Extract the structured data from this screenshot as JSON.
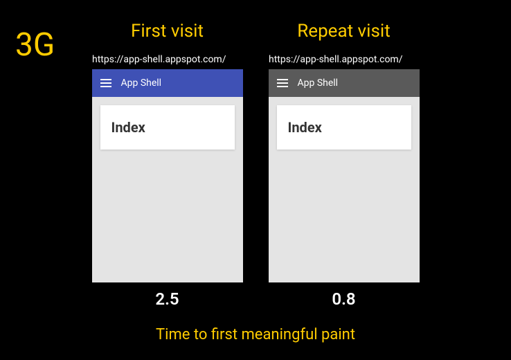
{
  "badge": "3G",
  "columns": {
    "first": {
      "title": "First visit",
      "url": "https://app-shell.appspot.com/",
      "appbar_title": "App Shell",
      "card_title": "Index",
      "timing": "2.5"
    },
    "repeat": {
      "title": "Repeat visit",
      "url": "https://app-shell.appspot.com/",
      "appbar_title": "App Shell",
      "card_title": "Index",
      "timing": "0.8"
    }
  },
  "caption": "Time to first meaningful paint"
}
